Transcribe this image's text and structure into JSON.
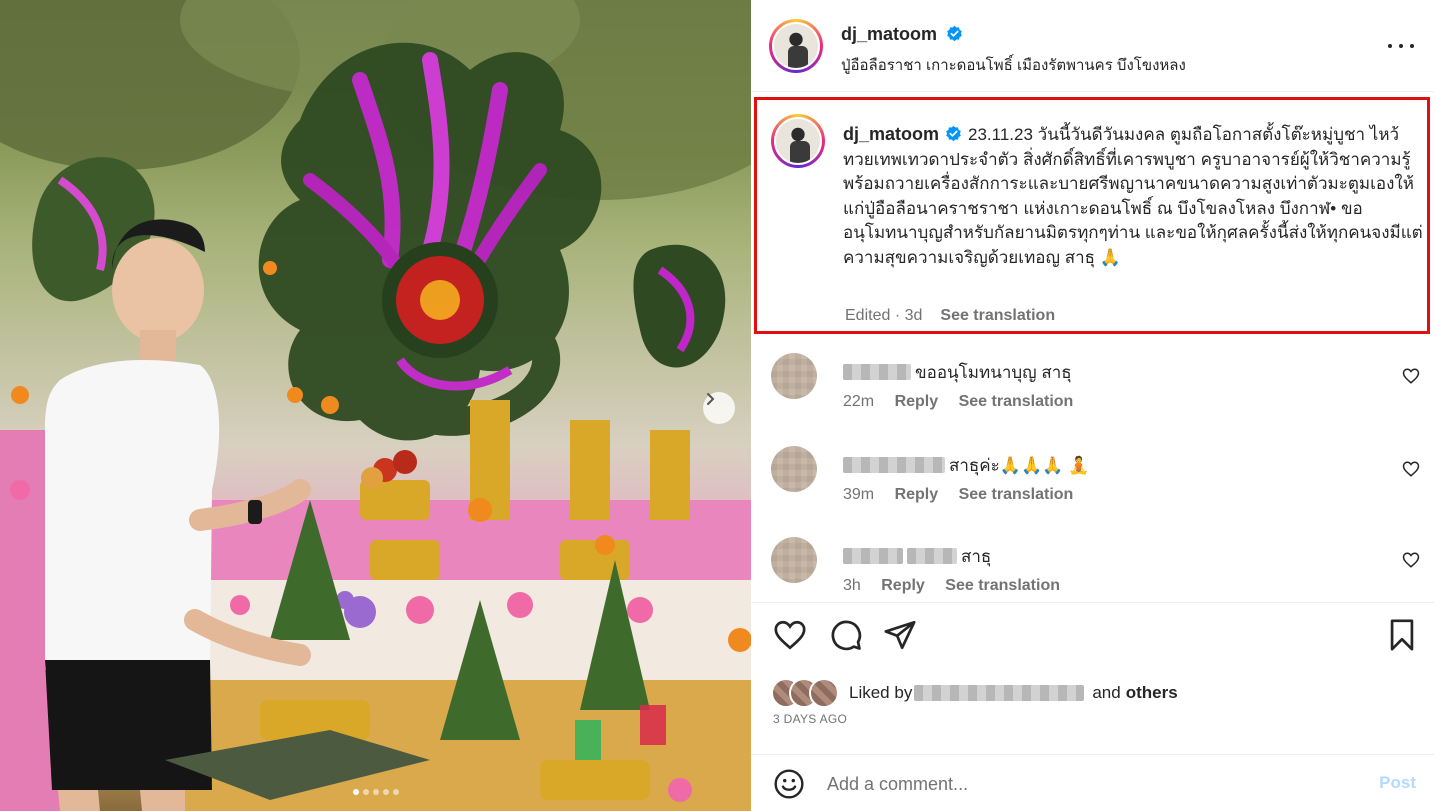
{
  "post": {
    "username": "dj_matoom",
    "location": "ปู่อือลือราชา เกาะดอนโพธิ์ เมืองรัตพานคร บึงโขงหลง",
    "caption": "23.11.23 วันนี้วันดีวันมงคล ตูมถือโอกาสตั้งโต๊ะหมู่บูชา ไหว้ทวยเทพเทวดาประจำตัว สิ่งศักดิ์สิทธิ์ที่เคารพบูชา ครูบาอาจารย์ผู้ให้วิชาความรู้ พร้อมถวายเครื่องสักการะและบายศรีพญานาคขนาดความสูงเท่าตัวมะตูมเองให้แก่ปู่อือลือนาคราชราชา แห่งเกาะดอนโพธิ์ ณ บึงโขลงโหลง บึงกาฬ• ขออนุโมทนาบุญสำหรับกัลยานมิตรทุกๆท่าน และขอให้กุศลครั้งนี้ส่งให้ทุกคนจงมีแต่ความสุขความเจริญด้วยเทอญ สาธุ 🙏",
    "edited": "Edited · 3d",
    "see_translation": "See translation"
  },
  "comments": [
    {
      "text": "ขออนุโมทนาบุญ สาธุ",
      "time": "22m",
      "reply": "Reply",
      "translate": "See translation"
    },
    {
      "text": "สาธุค่ะ🙏🙏🙏 🧘",
      "time": "39m",
      "reply": "Reply",
      "translate": "See translation"
    },
    {
      "text": "สาธุ",
      "time": "3h",
      "reply": "Reply",
      "translate": "See translation"
    }
  ],
  "likes": {
    "prefix": "Liked by",
    "and": "and",
    "others": "others",
    "ago": "3 DAYS AGO"
  },
  "composer": {
    "placeholder": "Add a comment...",
    "post_label": "Post"
  },
  "colors": {
    "highlight_border": "#e01010",
    "verified_blue": "#0095f6",
    "post_disabled": "#b3dbff"
  }
}
